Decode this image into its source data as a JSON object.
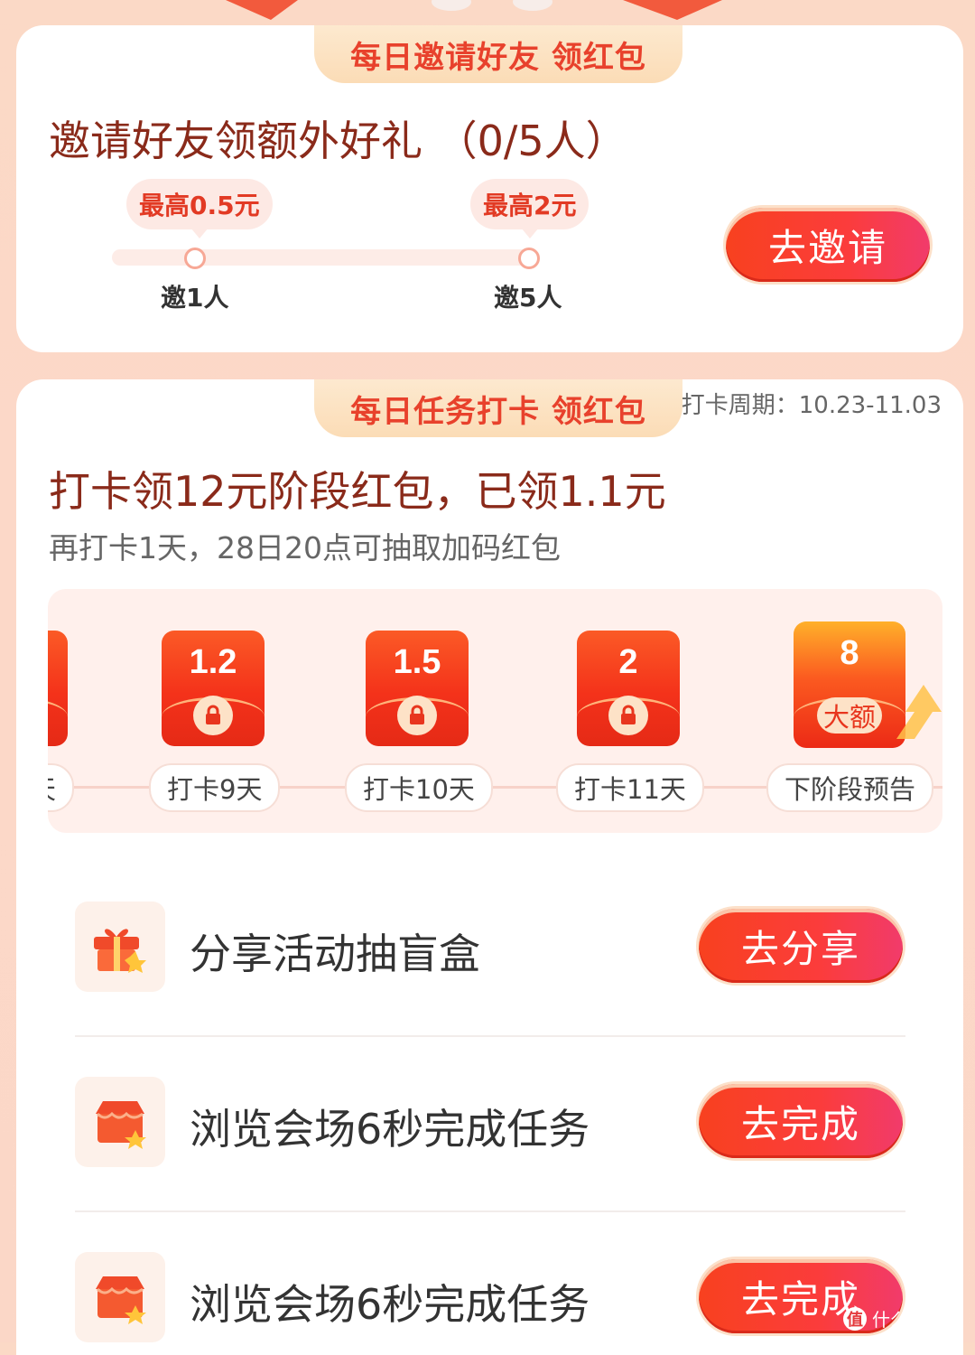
{
  "invite": {
    "ribbon": "每日邀请好友 领红包",
    "title": "邀请好友领额外好礼 （0/5人）",
    "milestones": [
      {
        "bubble": "最高0.5元",
        "label": "邀1人"
      },
      {
        "bubble": "最高2元",
        "label": "邀5人"
      }
    ],
    "button": "去邀请"
  },
  "checkin": {
    "ribbon": "每日任务打卡 领红包",
    "cycle": "打卡周期：10.23-11.03",
    "title": "打卡领12元阶段红包，已领1.1元",
    "subtitle": "再打卡1天，28日20点可抽取加码红包",
    "days": [
      {
        "amount": "",
        "label": "天"
      },
      {
        "amount": "1.2",
        "label": "打卡9天"
      },
      {
        "amount": "1.5",
        "label": "打卡10天"
      },
      {
        "amount": "2",
        "label": "打卡11天"
      },
      {
        "amount": "8",
        "badge": "大额",
        "label": "下阶段预告"
      }
    ]
  },
  "tasks": [
    {
      "icon": "gift-icon",
      "title": "分享活动抽盲盒",
      "button": "去分享"
    },
    {
      "icon": "store-icon",
      "title": "浏览会场6秒完成任务",
      "button": "去完成"
    },
    {
      "icon": "store-icon",
      "title": "浏览会场6秒完成任务",
      "button": "去完成"
    }
  ],
  "watermark": "什么值得买",
  "watermark_logo": "值",
  "colors": {
    "accent": "#f5401f",
    "title": "#8a2a1a",
    "ribbon_text": "#e8412c"
  }
}
